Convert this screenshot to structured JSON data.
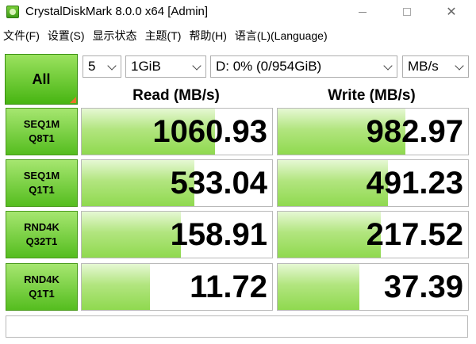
{
  "window": {
    "title": "CrystalDiskMark 8.0.0 x64 [Admin]",
    "minimize_label": "—",
    "maximize_label": "☐",
    "close_label": "✕"
  },
  "menu": {
    "items": [
      "文件(F)",
      "设置(S)",
      "显示状态",
      "主题(T)",
      "帮助(H)",
      "语言(L)(Language)"
    ]
  },
  "toolbar": {
    "all_label": "All",
    "count": "5",
    "size": "1GiB",
    "drive": "D: 0% (0/954GiB)",
    "unit": "MB/s"
  },
  "headers": {
    "read": "Read (MB/s)",
    "write": "Write (MB/s)"
  },
  "rows": [
    {
      "line1": "SEQ1M",
      "line2": "Q8T1",
      "read": "1060.93",
      "write": "982.97",
      "read_fill": 0.7,
      "write_fill": 0.67
    },
    {
      "line1": "SEQ1M",
      "line2": "Q1T1",
      "read": "533.04",
      "write": "491.23",
      "read_fill": 0.59,
      "write_fill": 0.58
    },
    {
      "line1": "RND4K",
      "line2": "Q32T1",
      "read": "158.91",
      "write": "217.52",
      "read_fill": 0.52,
      "write_fill": 0.54
    },
    {
      "line1": "RND4K",
      "line2": "Q1T1",
      "read": "11.72",
      "write": "37.39",
      "read_fill": 0.36,
      "write_fill": 0.43
    }
  ],
  "comment": "",
  "colors": {
    "accent_green": "#47b512",
    "corner_orange": "#e8742a"
  }
}
